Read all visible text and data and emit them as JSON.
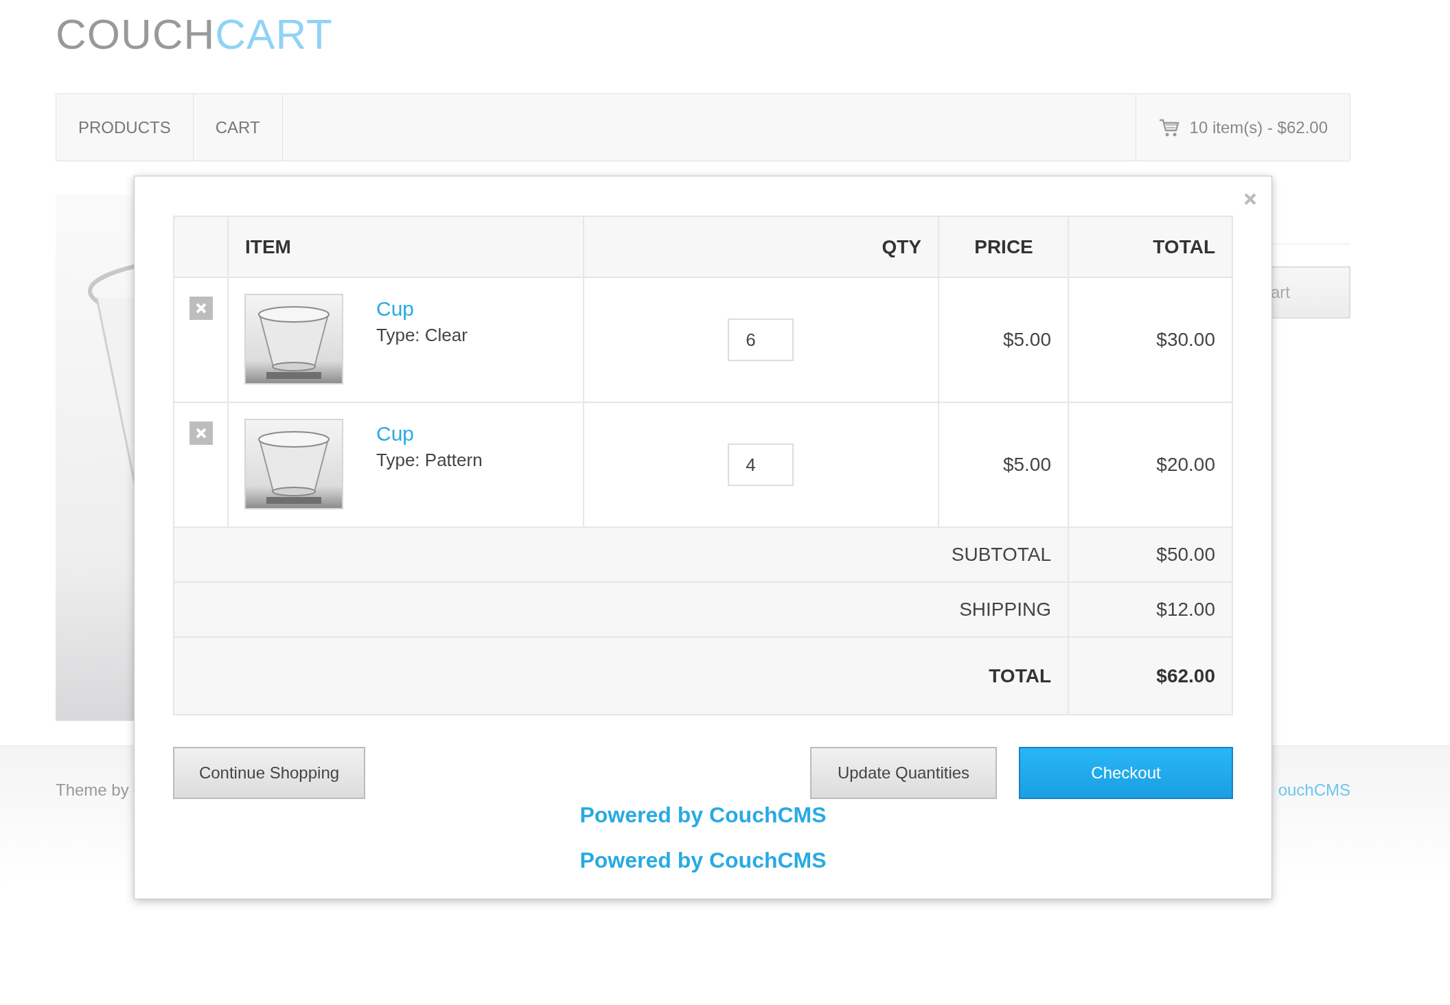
{
  "logo": {
    "part1": "COUCH",
    "part2": "CART"
  },
  "nav": {
    "items": [
      {
        "label": "PRODUCTS"
      },
      {
        "label": "CART"
      }
    ],
    "cart_summary": "10 item(s) - $62.00"
  },
  "background": {
    "button": "art",
    "footer_left": "Theme by",
    "footer_right": "ouchCMS"
  },
  "modal": {
    "columns": [
      "ITEM",
      "QTY",
      "PRICE",
      "TOTAL"
    ],
    "rows": [
      {
        "name": "Cup",
        "type": "Type: Clear",
        "qty": "6",
        "price": "$5.00",
        "total": "$30.00"
      },
      {
        "name": "Cup",
        "type": "Type: Pattern",
        "qty": "4",
        "price": "$5.00",
        "total": "$20.00"
      }
    ],
    "summary": [
      {
        "label": "SUBTOTAL",
        "value": "$50.00",
        "kind": "normal"
      },
      {
        "label": "SHIPPING",
        "value": "$12.00",
        "kind": "normal"
      },
      {
        "label": "TOTAL",
        "value": "$62.00",
        "kind": "grand"
      }
    ],
    "buttons": [
      {
        "label": "Continue Shopping",
        "kind": "default"
      },
      {
        "label": "Update Quantities",
        "kind": "default"
      },
      {
        "label": "Checkout",
        "kind": "primary"
      }
    ],
    "footer_links": [
      "Powered by CouchCMS",
      "Powered by CouchCMS"
    ]
  }
}
